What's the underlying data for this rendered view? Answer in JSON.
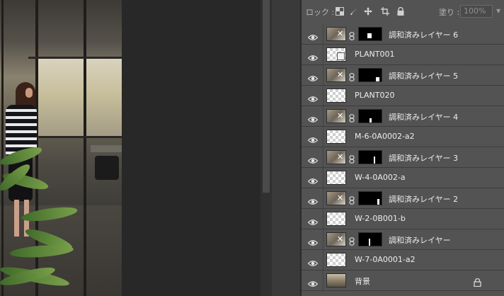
{
  "canvas": {
    "background": "#282828",
    "photo": "office interior with woman standing at glass partition and potted palm"
  },
  "layers_panel": {
    "lock_label": "ロック :",
    "lock_icons": [
      "checkerboard-icon",
      "brush-icon",
      "move-icon",
      "artboard-icon",
      "lock-icon"
    ],
    "fill_label": "塗り :",
    "fill_value": "100%",
    "layers": [
      {
        "name": "調和済みレイヤー 6",
        "kind": "adjustment",
        "visible": true
      },
      {
        "name": "PLANT001",
        "kind": "smart",
        "visible": true
      },
      {
        "name": "調和済みレイヤー 5",
        "kind": "adjustment",
        "visible": true
      },
      {
        "name": "PLANT020",
        "kind": "pixel",
        "visible": true
      },
      {
        "name": "調和済みレイヤー 4",
        "kind": "adjustment",
        "visible": true
      },
      {
        "name": "M-6-0A0002-a2",
        "kind": "pixel",
        "visible": true
      },
      {
        "name": "調和済みレイヤー 3",
        "kind": "adjustment",
        "visible": true
      },
      {
        "name": "W-4-0A002-a",
        "kind": "pixel",
        "visible": true
      },
      {
        "name": "調和済みレイヤー 2",
        "kind": "adjustment",
        "visible": true
      },
      {
        "name": "W-2-0B001-b",
        "kind": "pixel",
        "visible": true
      },
      {
        "name": "調和済みレイヤー",
        "kind": "adjustment",
        "visible": true
      },
      {
        "name": "W-7-0A0001-a2",
        "kind": "pixel",
        "visible": true
      },
      {
        "name": "背景",
        "kind": "background",
        "visible": true,
        "locked": true
      }
    ]
  },
  "colors": {
    "panel_bg": "#535353",
    "row_divider": "#3d3d3d",
    "text": "#ececec",
    "dim_text": "#b8b8b8"
  }
}
